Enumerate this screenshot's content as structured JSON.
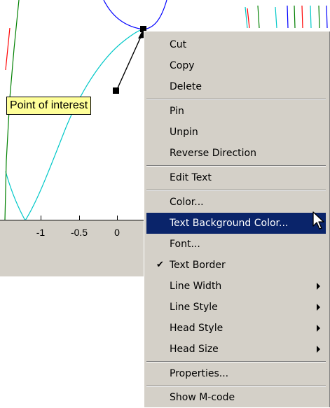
{
  "plot": {
    "x_ticks": [
      "-1",
      "-0.5",
      "0"
    ],
    "annotation_text": "Point of interest",
    "colors": {
      "cyan": "#00c8c8",
      "blue": "#0000ff",
      "green": "#008000",
      "red": "#ff0000",
      "axis_bg": "#d4d0c8",
      "label_bg": "#ffff99"
    }
  },
  "menu": {
    "items": [
      {
        "label": "Cut"
      },
      {
        "label": "Copy"
      },
      {
        "label": "Delete"
      },
      {
        "label": "Pin"
      },
      {
        "label": "Unpin"
      },
      {
        "label": "Reverse Direction"
      },
      {
        "label": "Edit Text"
      },
      {
        "label": "Color..."
      },
      {
        "label": "Text Background Color...",
        "highlighted": true
      },
      {
        "label": "Font..."
      },
      {
        "label": "Text Border",
        "checked": true
      },
      {
        "label": "Line Width",
        "submenu": true
      },
      {
        "label": "Line Style",
        "submenu": true
      },
      {
        "label": "Head Style",
        "submenu": true
      },
      {
        "label": "Head Size",
        "submenu": true
      },
      {
        "label": "Properties..."
      },
      {
        "label": "Show M-code"
      }
    ],
    "highlight_color": "#0a246a"
  }
}
